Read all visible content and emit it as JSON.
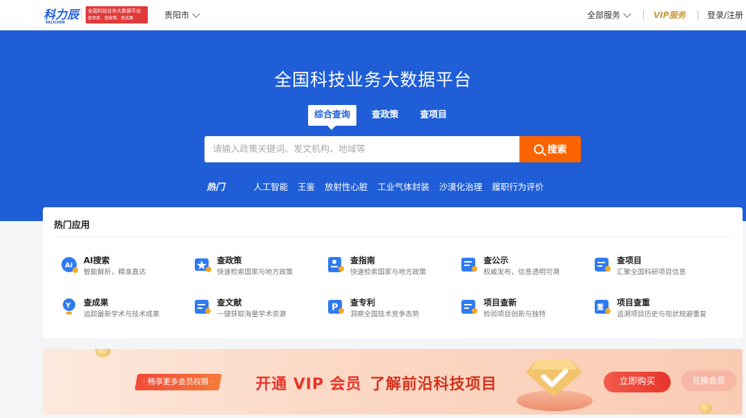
{
  "header": {
    "logo_text": "科力辰",
    "logo_sub": "KELICHEN",
    "tag_line1": "全国科技业务大数据平台",
    "tag_line2": "查项目、查政策、查成果",
    "city": "贵阳市",
    "services": "全部服务",
    "vip": "VIP服务",
    "login": "登录/注册"
  },
  "hero": {
    "title": "全国科技业务大数据平台",
    "tabs": [
      {
        "label": "综合查询",
        "active": true
      },
      {
        "label": "查政策",
        "active": false
      },
      {
        "label": "查项目",
        "active": false
      }
    ],
    "search_placeholder": "请输入政策关键词、发文机构、地域等",
    "search_button": "搜索",
    "hot_label": "热门",
    "hot_tags": [
      "人工智能",
      "王鉴",
      "放射性心脏",
      "工业气体封装",
      "沙漠化治理",
      "履职行为评价"
    ]
  },
  "apps": {
    "title": "热门应用",
    "items": [
      {
        "name": "AI搜索",
        "desc": "智能解析，精准直达",
        "icon": "ai-icon"
      },
      {
        "name": "查政策",
        "desc": "快速检索国家与地方政策",
        "icon": "policy-icon"
      },
      {
        "name": "查指南",
        "desc": "快速检索国家与地方政策",
        "icon": "guide-icon"
      },
      {
        "name": "查公示",
        "desc": "权威发布，信息透明可溯",
        "icon": "notice-icon"
      },
      {
        "name": "查项目",
        "desc": "汇聚全国科研项目信息",
        "icon": "project-icon"
      },
      {
        "name": "查成果",
        "desc": "追踪最新学术与技术成果",
        "icon": "achievement-icon"
      },
      {
        "name": "查文献",
        "desc": "一键获取海量学术资源",
        "icon": "literature-icon"
      },
      {
        "name": "查专利",
        "desc": "洞察全国技术竞争态势",
        "icon": "patent-icon"
      },
      {
        "name": "项目查新",
        "desc": "检验项目创新与独特",
        "icon": "novelty-icon"
      },
      {
        "name": "项目查重",
        "desc": "追溯项目历史与现状规避重复",
        "icon": "duplicate-icon"
      }
    ]
  },
  "banner": {
    "tag": "· 畅享更多会员权限 ·",
    "text1": "开通 VIP 会员",
    "text2": "了解前沿科技项目",
    "buy": "立即购买",
    "redeem": "兑换会员"
  },
  "colors": {
    "brand_blue": "#1f5ed6",
    "search_orange": "#fa6400",
    "vip_gold": "#c7993a",
    "banner_red": "#e8342a"
  }
}
